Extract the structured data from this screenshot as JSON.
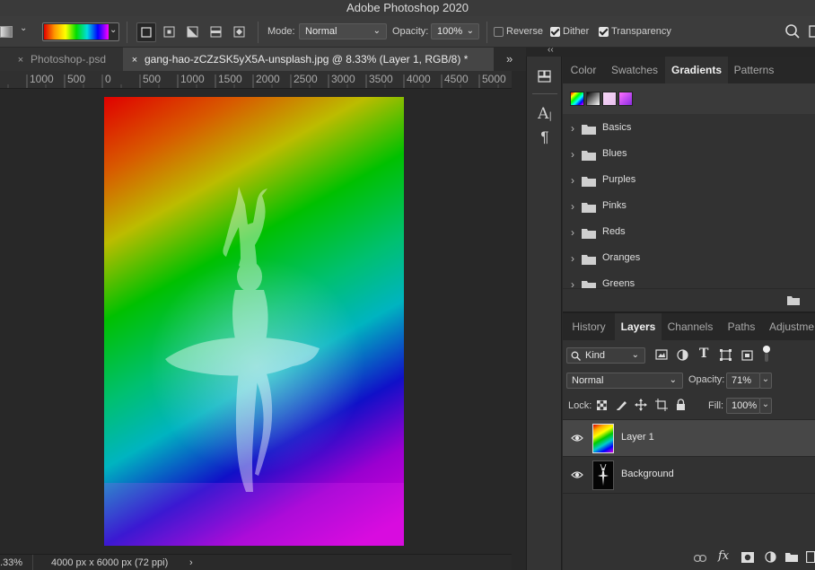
{
  "app": {
    "title": "Adobe Photoshop 2020"
  },
  "options": {
    "mode_label": "Mode:",
    "mode_value": "Normal",
    "opacity_label": "Opacity:",
    "opacity_value": "100%",
    "reverse_label": "Reverse",
    "reverse_checked": false,
    "dither_label": "Dither",
    "dither_checked": true,
    "transparency_label": "Transparency",
    "transparency_checked": true
  },
  "tabs": [
    {
      "label": "Photoshop-.psd",
      "close": "×",
      "active": false
    },
    {
      "label": "gang-hao-zCZzSK5yX5A-unsplash.jpg @ 8.33% (Layer 1, RGB/8) *",
      "close": "×",
      "active": true
    }
  ],
  "ruler": {
    "labels": [
      "1000",
      "500",
      "0",
      "500",
      "1000",
      "1500",
      "2000",
      "2500",
      "3000",
      "3500",
      "4000",
      "4500",
      "5000"
    ]
  },
  "status": {
    "zoom": ".33%",
    "doc_size": "4000 px x 6000 px (72 ppi)",
    "arrow": "›"
  },
  "gradient_panel": {
    "tabs": [
      "Color",
      "Swatches",
      "Gradients",
      "Patterns"
    ],
    "active_tab": "Gradients",
    "presets": [
      "spectrum",
      "black-white",
      "light-pink",
      "pink-purple"
    ],
    "folders": [
      "Basics",
      "Blues",
      "Purples",
      "Pinks",
      "Reds",
      "Oranges",
      "Greens"
    ]
  },
  "layers_panel": {
    "tabs": [
      "History",
      "Layers",
      "Channels",
      "Paths",
      "Adjustme"
    ],
    "active_tab": "Layers",
    "filter_value": "Kind",
    "blend_mode": "Normal",
    "opacity_label": "Opacity:",
    "opacity_value": "71%",
    "lock_label": "Lock:",
    "fill_label": "Fill:",
    "fill_value": "100%",
    "layers": [
      {
        "name": "Layer 1",
        "selected": true,
        "visible": true
      },
      {
        "name": "Background",
        "selected": false,
        "visible": true
      }
    ]
  },
  "colors": {
    "accent_selected": "#474747",
    "panel_bg": "#323232",
    "canvas_bg": "#282828"
  }
}
